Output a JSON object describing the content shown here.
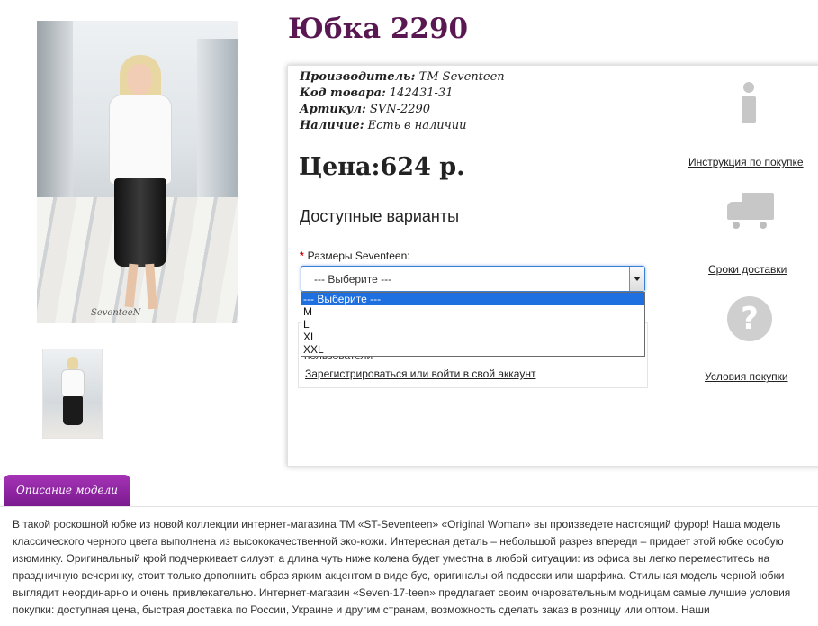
{
  "product": {
    "title": "Юбка 2290",
    "manufacturer_label": "Производитель:",
    "manufacturer_value": "ТМ Seventeen",
    "code_label": "Код товара:",
    "code_value": "142431-31",
    "article_label": "Артикул:",
    "article_value": "SVN-2290",
    "availability_label": "Наличие:",
    "availability_value": "Есть в наличии",
    "price": "Цена:624 р.",
    "variants_heading": "Доступные варианты",
    "photo_watermark": "SeventeeN"
  },
  "sizes": {
    "label": "Размеры Seventeen:",
    "selected": "--- Выберите ---",
    "options": [
      "--- Выберите ---",
      "M",
      "L",
      "XL",
      "XXL"
    ]
  },
  "login": {
    "note": "пользователи",
    "link": "Зарегистрироваться или войти в свой аккаунт"
  },
  "side_links": {
    "instructions": "Инструкция по покупке",
    "delivery": "Сроки доставки",
    "terms": "Условия покупки"
  },
  "icons": {
    "instructions": "info-icon",
    "delivery": "truck-icon",
    "terms": "question-icon"
  },
  "tabs": {
    "description": "Описание модели"
  },
  "colors": {
    "title": "#5a1852",
    "tab": "#8a2399",
    "select_border": "#3b7fd4",
    "option_selected": "#1e6fe0"
  },
  "description": "В такой роскошной юбке из новой коллекции интернет-магазина ТМ «ST-Seventeen» «Original Woman» вы произведете настоящий фурор! Наша модель классического черного цвета выполнена из высококачественной эко-кожи. Интересная деталь – небольшой разрез впереди – придает этой юбке особую изюминку. Оригинальный крой подчеркивает силуэт, а длина чуть ниже колена будет уместна в любой ситуации: из офиса вы легко переместитесь на праздничную вечеринку, стоит только дополнить образ ярким акцентом в виде бус, оригинальной подвески или шарфика. Стильная модель черной юбки выглядит неординарно и очень привлекательно. Интернет-магазин «Seven-17-teen» предлагает своим очаровательным модницам самые лучшие условия покупки: доступная цена, быстрая доставка по России, Украине и другим странам, возможность сделать заказ в розницу или оптом. Наши"
}
